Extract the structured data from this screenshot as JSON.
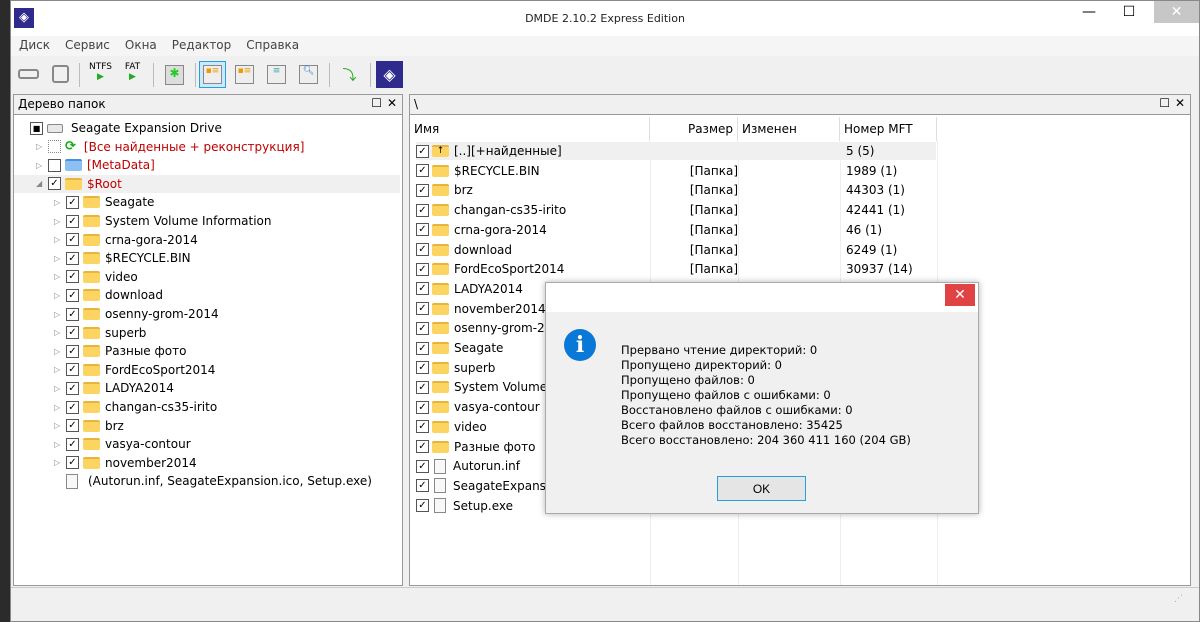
{
  "window": {
    "title": "DMDE 2.10.2 Express Edition",
    "minimize": "—",
    "maximize": "☐",
    "close": "✕"
  },
  "menu": [
    "Диск",
    "Сервис",
    "Окна",
    "Редактор",
    "Справка"
  ],
  "toolbar": {
    "ntfs": "NTFS",
    "fat": "FAT"
  },
  "tree": {
    "title": "Дерево папок",
    "items": [
      {
        "label": "Seagate Expansion Drive",
        "level": 0,
        "icon": "drive-icon",
        "check": "partial",
        "exp": ""
      },
      {
        "label": "[Все найденные + реконструкция]",
        "level": 1,
        "icon": "refresh-icon",
        "check": "dotted",
        "exp": "▷",
        "red": true
      },
      {
        "label": "[MetaData]",
        "level": 1,
        "icon": "folder-blue-icon",
        "check": "none",
        "exp": "▷",
        "red": true
      },
      {
        "label": "$Root",
        "level": 1,
        "icon": "folder-icon",
        "check": "checked",
        "exp": "◢",
        "red": true,
        "selected": true
      },
      {
        "label": "Seagate",
        "level": 2,
        "icon": "folder-icon",
        "check": "checked",
        "exp": "▷"
      },
      {
        "label": "System Volume Information",
        "level": 2,
        "icon": "folder-icon",
        "check": "checked",
        "exp": "▷"
      },
      {
        "label": "crna-gora-2014",
        "level": 2,
        "icon": "folder-icon",
        "check": "checked",
        "exp": "▷"
      },
      {
        "label": "$RECYCLE.BIN",
        "level": 2,
        "icon": "folder-icon",
        "check": "checked",
        "exp": "▷"
      },
      {
        "label": "video",
        "level": 2,
        "icon": "folder-icon",
        "check": "checked",
        "exp": "▷"
      },
      {
        "label": "download",
        "level": 2,
        "icon": "folder-icon",
        "check": "checked",
        "exp": "▷"
      },
      {
        "label": "osenny-grom-2014",
        "level": 2,
        "icon": "folder-icon",
        "check": "checked",
        "exp": "▷"
      },
      {
        "label": "superb",
        "level": 2,
        "icon": "folder-icon",
        "check": "checked",
        "exp": "▷"
      },
      {
        "label": "Разные фото",
        "level": 2,
        "icon": "folder-icon",
        "check": "checked",
        "exp": "▷"
      },
      {
        "label": "FordEcoSport2014",
        "level": 2,
        "icon": "folder-icon",
        "check": "checked",
        "exp": "▷"
      },
      {
        "label": "LADYA2014",
        "level": 2,
        "icon": "folder-icon",
        "check": "checked",
        "exp": "▷"
      },
      {
        "label": "changan-cs35-irito",
        "level": 2,
        "icon": "folder-icon",
        "check": "checked",
        "exp": "▷"
      },
      {
        "label": "brz",
        "level": 2,
        "icon": "folder-icon",
        "check": "checked",
        "exp": "▷"
      },
      {
        "label": "vasya-contour",
        "level": 2,
        "icon": "folder-icon",
        "check": "checked",
        "exp": "▷"
      },
      {
        "label": "november2014",
        "level": 2,
        "icon": "folder-icon",
        "check": "checked",
        "exp": "▷"
      },
      {
        "label": "(Autorun.inf, SeagateExpansion.ico, Setup.exe)",
        "level": 2,
        "icon": "files-icon",
        "check": "none",
        "exp": ""
      }
    ]
  },
  "list": {
    "path": "\\",
    "columns": [
      "Имя",
      "Размер",
      "Изменен",
      "Номер MFT"
    ],
    "rows": [
      {
        "name": "[..][+найденные]",
        "size": "",
        "mft": "5 (5)",
        "icon": "folder-up-icon"
      },
      {
        "name": "$RECYCLE.BIN",
        "size": "[Папка]",
        "mft": "1989 (1)",
        "icon": "folder-icon"
      },
      {
        "name": "brz",
        "size": "[Папка]",
        "mft": "44303 (1)",
        "icon": "folder-icon"
      },
      {
        "name": "changan-cs35-irito",
        "size": "[Папка]",
        "mft": "42441 (1)",
        "icon": "folder-icon"
      },
      {
        "name": "crna-gora-2014",
        "size": "[Папка]",
        "mft": "46 (1)",
        "icon": "folder-icon"
      },
      {
        "name": "download",
        "size": "[Папка]",
        "mft": "6249 (1)",
        "icon": "folder-icon"
      },
      {
        "name": "FordEcoSport2014",
        "size": "[Папка]",
        "mft": "30937 (14)",
        "icon": "folder-icon"
      },
      {
        "name": "LADYA2014",
        "size": "",
        "mft": "",
        "icon": "folder-icon"
      },
      {
        "name": "november2014",
        "size": "",
        "mft": "",
        "icon": "folder-icon"
      },
      {
        "name": "osenny-grom-20",
        "size": "",
        "mft": "",
        "icon": "folder-icon"
      },
      {
        "name": "Seagate",
        "size": "",
        "mft": "",
        "icon": "folder-icon"
      },
      {
        "name": "superb",
        "size": "",
        "mft": "",
        "icon": "folder-icon"
      },
      {
        "name": "System Volume In",
        "size": "",
        "mft": "",
        "icon": "folder-icon"
      },
      {
        "name": "vasya-contour",
        "size": "",
        "mft": "",
        "icon": "folder-icon"
      },
      {
        "name": "video",
        "size": "",
        "mft": "",
        "icon": "folder-icon"
      },
      {
        "name": "Разные фото",
        "size": "",
        "mft": "",
        "icon": "folder-icon"
      },
      {
        "name": "Autorun.inf",
        "size": "",
        "mft": "",
        "icon": "file-icon"
      },
      {
        "name": "SeagateExpansion",
        "size": "",
        "mft": "",
        "icon": "file-icon"
      },
      {
        "name": "Setup.exe",
        "size": "",
        "mft": "",
        "icon": "file-icon"
      }
    ]
  },
  "dialog": {
    "close": "✕",
    "icon": "info-icon",
    "lines": [
      "Прервано чтение директорий: 0",
      "Пропущено директорий: 0",
      "Пропущено файлов: 0",
      "Пропущено файлов с ошибками: 0",
      "Восстановлено файлов с ошибками: 0",
      "Всего файлов восстановлено: 35425",
      "Всего восстановлено: 204 360 411 160 (204 GB)"
    ],
    "ok": "OK"
  },
  "colors": {
    "accent": "#26a0da",
    "close_red": "#e04343",
    "info_blue": "#0a78d7",
    "folder": "#fcd462"
  }
}
